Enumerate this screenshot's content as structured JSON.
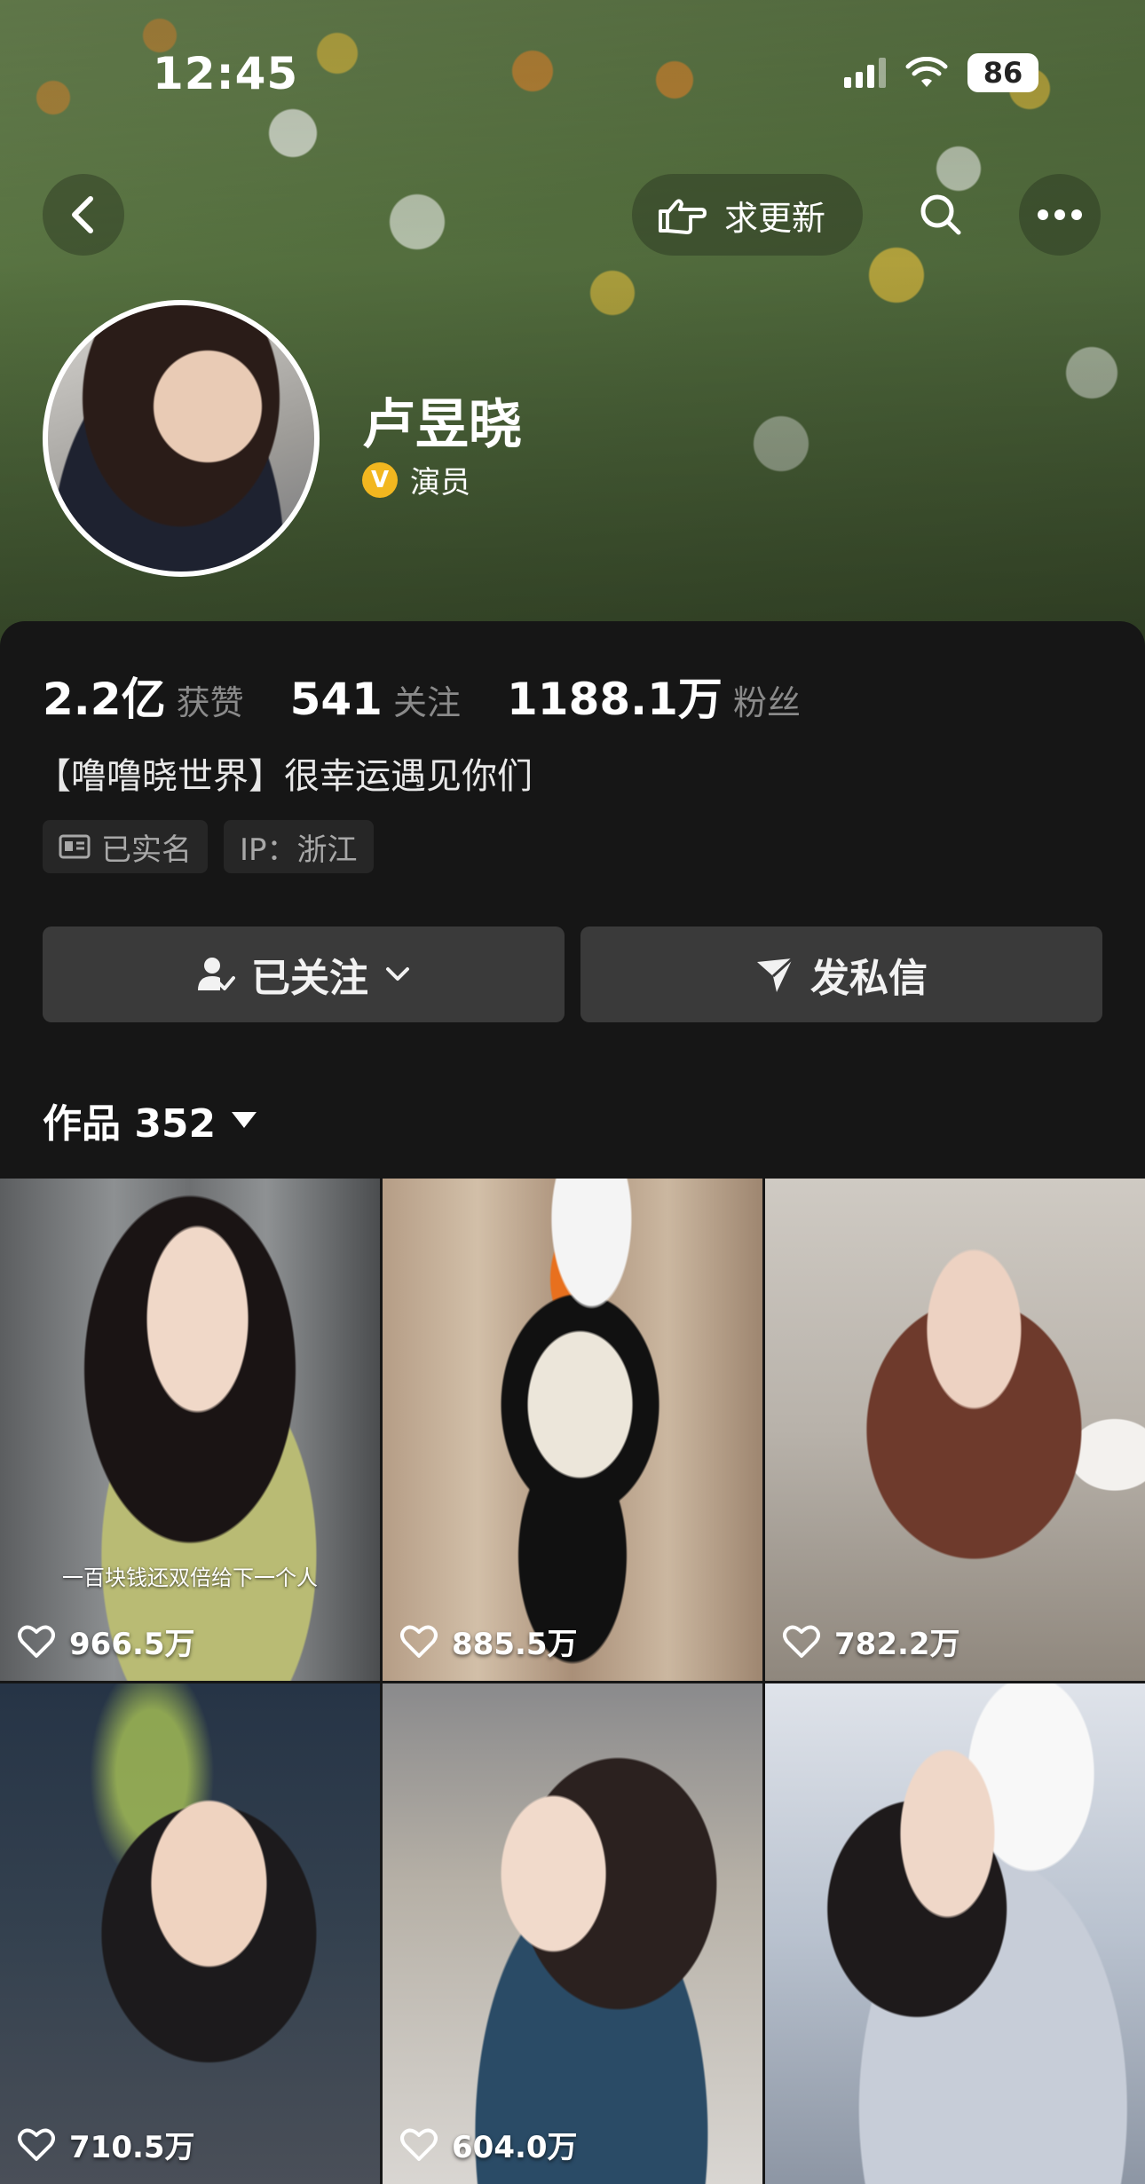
{
  "status_bar": {
    "time": "12:45",
    "battery": "86"
  },
  "nav": {
    "back_icon": "chevron-left-icon",
    "request_update_label": "求更新",
    "request_update_icon": "hand-pointing-icon",
    "search_icon": "search-icon",
    "more_icon": "more-dots-icon"
  },
  "profile": {
    "name": "卢昱晓",
    "verify_badge": "V",
    "verify_label": "演员",
    "bio": "【噜噜晓世界】很幸运遇见你们",
    "tags": [
      {
        "icon": "id-card-icon",
        "label": "已实名"
      },
      {
        "icon": "",
        "label": "IP：浙江"
      }
    ],
    "stats": [
      {
        "value": "2.2亿",
        "label": "获赞"
      },
      {
        "value": "541",
        "label": "关注"
      },
      {
        "value": "1188.1万",
        "label": "粉丝"
      }
    ]
  },
  "actions": {
    "follow_label": "已关注",
    "message_label": "发私信"
  },
  "works": {
    "label": "作品 352"
  },
  "grid": [
    {
      "likes": "966.5万",
      "caption": "一百块钱还双倍给下一个人"
    },
    {
      "likes": "885.5万",
      "caption": ""
    },
    {
      "likes": "782.2万",
      "caption": ""
    },
    {
      "likes": "710.5万",
      "caption": ""
    },
    {
      "likes": "604.0万",
      "caption": ""
    },
    {
      "likes": "",
      "caption": ""
    }
  ],
  "colors": {
    "background": "#161616",
    "button_bg": "#3a3a3a",
    "secondary_text": "#8a8a8a",
    "verify_gold": "#f2b71f"
  }
}
